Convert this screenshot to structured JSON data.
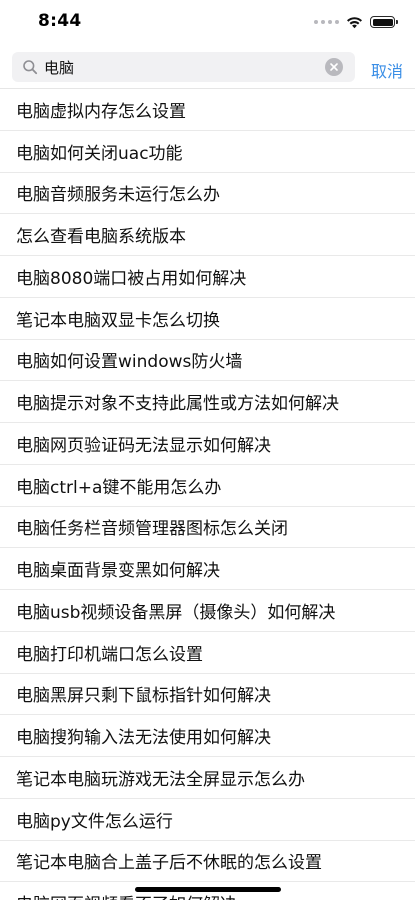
{
  "status_bar": {
    "time": "8:44"
  },
  "search": {
    "query": "电脑",
    "placeholder": "",
    "cancel_label": "取消"
  },
  "suggestions": [
    "电脑虚拟内存怎么设置",
    "电脑如何关闭uac功能",
    "电脑音频服务未运行怎么办",
    "怎么查看电脑系统版本",
    "电脑8080端口被占用如何解决",
    "笔记本电脑双显卡怎么切换",
    "电脑如何设置windows防火墙",
    "电脑提示对象不支持此属性或方法如何解决",
    "电脑网页验证码无法显示如何解决",
    "电脑ctrl+a键不能用怎么办",
    "电脑任务栏音频管理器图标怎么关闭",
    "电脑桌面背景变黑如何解决",
    "电脑usb视频设备黑屏（摄像头）如何解决",
    "电脑打印机端口怎么设置",
    "电脑黑屏只剩下鼠标指针如何解决",
    "电脑搜狗输入法无法使用如何解决",
    "笔记本电脑玩游戏无法全屏显示怎么办",
    "电脑py文件怎么运行",
    "笔记本电脑合上盖子后不休眠的怎么设置",
    "电脑网页视频看不了如何解决"
  ],
  "colors": {
    "accent": "#3a8ee6",
    "search_field_bg": "#f1f1f3",
    "divider": "#e9e9e9"
  },
  "icons": {
    "search": "search-icon",
    "clear": "clear-icon",
    "wifi": "wifi-icon",
    "battery": "battery-icon",
    "signal": "cellular-signal-icon"
  }
}
